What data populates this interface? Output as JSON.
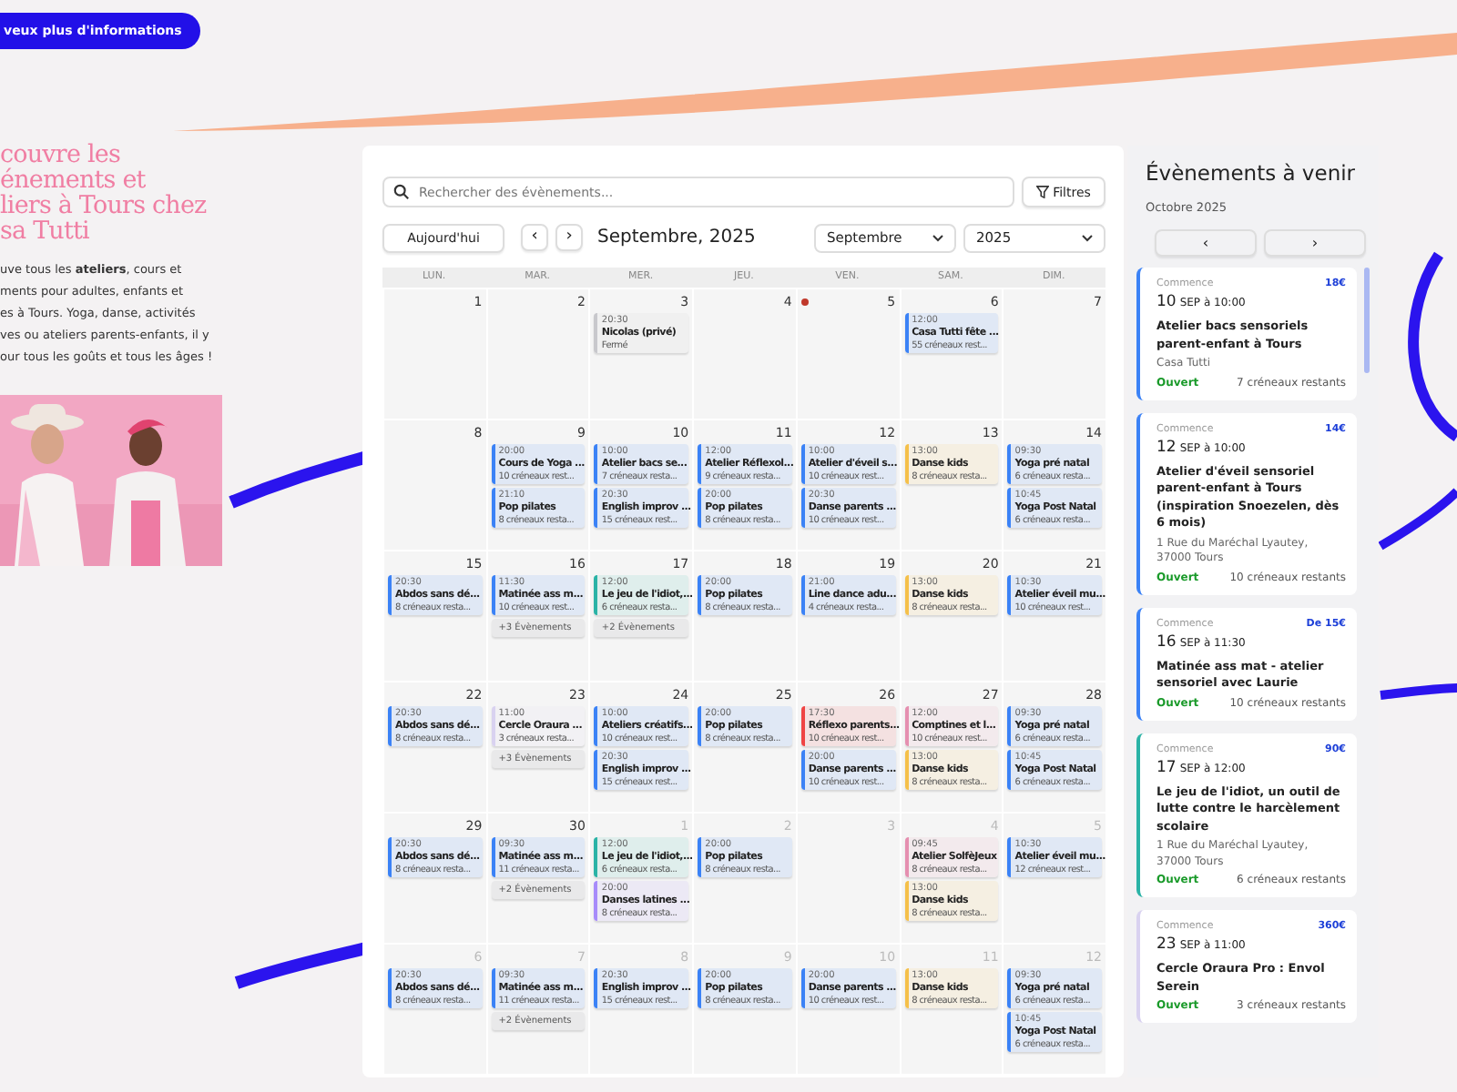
{
  "info_button": "veux plus d'informations",
  "intro": {
    "heading": [
      "couvre les",
      "énements et",
      "liers à Tours chez",
      "sa Tutti"
    ],
    "text": [
      "uve tous les **ateliers**, cours et",
      "ments pour adultes, enfants et",
      "es à Tours. Yoga, danse, activités",
      "ves ou ateliers parents-enfants, il y",
      "our tous les goûts et tous les âges !"
    ]
  },
  "calendar": {
    "search": {
      "placeholder": "Rechercher des évènements..."
    },
    "filter_button": "Filtres",
    "today_button": "Aujourd'hui",
    "prev": "‹",
    "next": "›",
    "title": "Septembre, 2025",
    "month_select": "Septembre",
    "year_select": "2025",
    "weekdays": [
      "LUN.",
      "MAR.",
      "MER.",
      "JEU.",
      "VEN.",
      "SAM.",
      "DIM."
    ],
    "weeks": [
      [
        {
          "day": "1",
          "current_month": true,
          "marker": false
        },
        {
          "day": "2",
          "current_month": true,
          "marker": false
        },
        {
          "day": "3",
          "current_month": true,
          "marker": false,
          "events": [
            {
              "time": "20:30",
              "title": "Nicolas (privé)",
              "slots": "Fermé",
              "color": "#c8c8cc"
            }
          ]
        },
        {
          "day": "4",
          "current_month": true,
          "marker": false
        },
        {
          "day": "5",
          "current_month": true,
          "marker": true
        },
        {
          "day": "6",
          "current_month": true,
          "marker": false,
          "events": [
            {
              "time": "12:00",
              "title": "Casa Tutti fête ...",
              "slots": "55 créneaux rest...",
              "color": "#3b82f6"
            }
          ]
        },
        {
          "day": "7",
          "current_month": true,
          "marker": false
        }
      ],
      [
        {
          "day": "8",
          "current_month": true,
          "marker": false
        },
        {
          "day": "9",
          "current_month": true,
          "marker": false,
          "events": [
            {
              "time": "20:00",
              "title": "Cours de Yoga ...",
              "slots": "10 créneaux rest...",
              "color": "#3b82f6"
            },
            {
              "time": "21:10",
              "title": "Pop pilates",
              "slots": "8 créneaux resta...",
              "color": "#3b82f6"
            }
          ]
        },
        {
          "day": "10",
          "current_month": true,
          "marker": false,
          "events": [
            {
              "time": "10:00",
              "title": "Atelier bacs se...",
              "slots": "7 créneaux resta...",
              "color": "#3b82f6"
            },
            {
              "time": "20:30",
              "title": "English improv ...",
              "slots": "15 créneaux rest...",
              "color": "#3b82f6"
            }
          ]
        },
        {
          "day": "11",
          "current_month": true,
          "marker": false,
          "events": [
            {
              "time": "12:00",
              "title": "Atelier Réflexol...",
              "slots": "9 créneaux resta...",
              "color": "#3b82f6"
            },
            {
              "time": "20:00",
              "title": "Pop pilates",
              "slots": "8 créneaux resta...",
              "color": "#3b82f6"
            }
          ]
        },
        {
          "day": "12",
          "current_month": true,
          "marker": false,
          "events": [
            {
              "time": "10:00",
              "title": "Atelier d'éveil s...",
              "slots": "10 créneaux rest...",
              "color": "#3b82f6"
            },
            {
              "time": "20:30",
              "title": "Danse parents ...",
              "slots": "10 créneaux rest...",
              "color": "#3b82f6"
            }
          ]
        },
        {
          "day": "13",
          "current_month": true,
          "marker": false,
          "events": [
            {
              "time": "13:00",
              "title": "Danse kids",
              "slots": "8 créneaux resta...",
              "color": "#f5c04a"
            }
          ]
        },
        {
          "day": "14",
          "current_month": true,
          "marker": false,
          "events": [
            {
              "time": "09:30",
              "title": "Yoga pré natal",
              "slots": "6 créneaux resta...",
              "color": "#3b82f6"
            },
            {
              "time": "10:45",
              "title": "Yoga Post Natal",
              "slots": "6 créneaux resta...",
              "color": "#3b82f6"
            }
          ]
        }
      ],
      [
        {
          "day": "15",
          "current_month": true,
          "marker": false,
          "events": [
            {
              "time": "20:30",
              "title": "Abdos sans dé...",
              "slots": "8 créneaux resta...",
              "color": "#3b82f6"
            }
          ]
        },
        {
          "day": "16",
          "current_month": true,
          "marker": false,
          "events": [
            {
              "time": "11:30",
              "title": "Matinée ass m...",
              "slots": "10 créneaux rest...",
              "color": "#3b82f6"
            }
          ],
          "more": "+3 Évènements"
        },
        {
          "day": "17",
          "current_month": true,
          "marker": false,
          "events": [
            {
              "time": "12:00",
              "title": "Le jeu de l'idiot,...",
              "slots": "6 créneaux resta...",
              "color": "#2ab3a6"
            }
          ],
          "more": "+2 Évènements"
        },
        {
          "day": "18",
          "current_month": true,
          "marker": false,
          "events": [
            {
              "time": "20:00",
              "title": "Pop pilates",
              "slots": "8 créneaux resta...",
              "color": "#3b82f6"
            }
          ]
        },
        {
          "day": "19",
          "current_month": true,
          "marker": false,
          "events": [
            {
              "time": "21:00",
              "title": "Line dance adu...",
              "slots": "4 créneaux resta...",
              "color": "#3b82f6"
            }
          ]
        },
        {
          "day": "20",
          "current_month": true,
          "marker": false,
          "events": [
            {
              "time": "13:00",
              "title": "Danse kids",
              "slots": "8 créneaux resta...",
              "color": "#f5c04a"
            }
          ]
        },
        {
          "day": "21",
          "current_month": true,
          "marker": false,
          "events": [
            {
              "time": "10:30",
              "title": "Atelier éveil mu...",
              "slots": "10 créneaux rest...",
              "color": "#3b82f6"
            }
          ]
        }
      ],
      [
        {
          "day": "22",
          "current_month": true,
          "marker": false,
          "events": [
            {
              "time": "20:30",
              "title": "Abdos sans dé...",
              "slots": "8 créneaux resta...",
              "color": "#3b82f6"
            }
          ]
        },
        {
          "day": "23",
          "current_month": true,
          "marker": false,
          "events": [
            {
              "time": "11:00",
              "title": "Cercle Oraura ...",
              "slots": "3 créneaux resta...",
              "color": "#d9d2f0"
            }
          ],
          "more": "+3 Évènements"
        },
        {
          "day": "24",
          "current_month": true,
          "marker": false,
          "events": [
            {
              "time": "10:00",
              "title": "Ateliers créatifs...",
              "slots": "10 créneaux rest...",
              "color": "#3b82f6"
            },
            {
              "time": "20:30",
              "title": "English improv ...",
              "slots": "15 créneaux rest...",
              "color": "#3b82f6"
            }
          ]
        },
        {
          "day": "25",
          "current_month": true,
          "marker": false,
          "events": [
            {
              "time": "20:00",
              "title": "Pop pilates",
              "slots": "8 créneaux resta...",
              "color": "#3b82f6"
            }
          ]
        },
        {
          "day": "26",
          "current_month": true,
          "marker": false,
          "events": [
            {
              "time": "17:30",
              "title": "Réflexo parents...",
              "slots": "10 créneaux rest...",
              "color": "#ef4444"
            },
            {
              "time": "20:00",
              "title": "Danse parents ...",
              "slots": "10 créneaux rest...",
              "color": "#3b82f6"
            }
          ]
        },
        {
          "day": "27",
          "current_month": true,
          "marker": false,
          "events": [
            {
              "time": "12:00",
              "title": "Comptines et l...",
              "slots": "10 créneaux rest...",
              "color": "#e58fb0"
            },
            {
              "time": "13:00",
              "title": "Danse kids",
              "slots": "8 créneaux resta...",
              "color": "#f5c04a"
            }
          ]
        },
        {
          "day": "28",
          "current_month": true,
          "marker": false,
          "events": [
            {
              "time": "09:30",
              "title": "Yoga pré natal",
              "slots": "6 créneaux resta...",
              "color": "#3b82f6"
            },
            {
              "time": "10:45",
              "title": "Yoga Post Natal",
              "slots": "6 créneaux resta...",
              "color": "#3b82f6"
            }
          ]
        }
      ],
      [
        {
          "day": "29",
          "current_month": true,
          "marker": false,
          "events": [
            {
              "time": "20:30",
              "title": "Abdos sans dé...",
              "slots": "8 créneaux resta...",
              "color": "#3b82f6"
            }
          ]
        },
        {
          "day": "30",
          "current_month": true,
          "marker": false,
          "events": [
            {
              "time": "09:30",
              "title": "Matinée ass m...",
              "slots": "11 créneaux resta...",
              "color": "#3b82f6"
            }
          ],
          "more": "+2 Évènements"
        },
        {
          "day": "1",
          "current_month": false,
          "marker": false,
          "events": [
            {
              "time": "12:00",
              "title": "Le jeu de l'idiot,...",
              "slots": "6 créneaux resta...",
              "color": "#2ab3a6"
            },
            {
              "time": "20:00",
              "title": "Danses latines ...",
              "slots": "8 créneaux resta...",
              "color": "#a78bfa"
            }
          ]
        },
        {
          "day": "2",
          "current_month": false,
          "marker": false,
          "events": [
            {
              "time": "20:00",
              "title": "Pop pilates",
              "slots": "8 créneaux resta...",
              "color": "#3b82f6"
            }
          ]
        },
        {
          "day": "3",
          "current_month": false,
          "marker": false
        },
        {
          "day": "4",
          "current_month": false,
          "marker": false,
          "events": [
            {
              "time": "09:45",
              "title": "Atelier SolfèJeux",
              "slots": "8 créneaux resta...",
              "color": "#e58fb0"
            },
            {
              "time": "13:00",
              "title": "Danse kids",
              "slots": "8 créneaux resta...",
              "color": "#f5c04a"
            }
          ]
        },
        {
          "day": "5",
          "current_month": false,
          "marker": false,
          "events": [
            {
              "time": "10:30",
              "title": "Atelier éveil mu...",
              "slots": "12 créneaux rest...",
              "color": "#3b82f6"
            }
          ]
        }
      ],
      [
        {
          "day": "6",
          "current_month": false,
          "marker": false,
          "events": [
            {
              "time": "20:30",
              "title": "Abdos sans dé...",
              "slots": "8 créneaux resta...",
              "color": "#3b82f6"
            }
          ]
        },
        {
          "day": "7",
          "current_month": false,
          "marker": false,
          "events": [
            {
              "time": "09:30",
              "title": "Matinée ass m...",
              "slots": "11 créneaux resta...",
              "color": "#3b82f6"
            }
          ],
          "more": "+2 Évènements"
        },
        {
          "day": "8",
          "current_month": false,
          "marker": false,
          "events": [
            {
              "time": "20:30",
              "title": "English improv ...",
              "slots": "15 créneaux rest...",
              "color": "#3b82f6"
            }
          ]
        },
        {
          "day": "9",
          "current_month": false,
          "marker": false,
          "events": [
            {
              "time": "20:00",
              "title": "Pop pilates",
              "slots": "8 créneaux resta...",
              "color": "#3b82f6"
            }
          ]
        },
        {
          "day": "10",
          "current_month": false,
          "marker": false,
          "events": [
            {
              "time": "20:00",
              "title": "Danse parents ...",
              "slots": "10 créneaux rest...",
              "color": "#3b82f6"
            }
          ]
        },
        {
          "day": "11",
          "current_month": false,
          "marker": false,
          "events": [
            {
              "time": "13:00",
              "title": "Danse kids",
              "slots": "8 créneaux resta...",
              "color": "#f5c04a"
            }
          ]
        },
        {
          "day": "12",
          "current_month": false,
          "marker": false,
          "events": [
            {
              "time": "09:30",
              "title": "Yoga pré natal",
              "slots": "6 créneaux resta...",
              "color": "#3b82f6"
            },
            {
              "time": "10:45",
              "title": "Yoga Post Natal",
              "slots": "6 créneaux resta...",
              "color": "#3b82f6"
            }
          ]
        }
      ]
    ]
  },
  "upcoming": {
    "title": "Évènements à venir",
    "month": "Octobre 2025",
    "prev": "‹",
    "next": "›",
    "cards": [
      {
        "label": "Commence",
        "price": "18€",
        "day": "10",
        "when": "SEP à 10:00",
        "title": "Atelier bacs sensoriels parent-enfant à Tours",
        "location": "Casa Tutti",
        "status": "Ouvert",
        "slots": "7 créneaux restants",
        "color": "#3b82f6"
      },
      {
        "label": "Commence",
        "price": "14€",
        "day": "12",
        "when": "SEP à 10:00",
        "title": "Atelier d'éveil sensoriel parent-enfant à Tours (inspiration Snoezelen, dès 6 mois)",
        "location": "1 Rue du Maréchal Lyautey, 37000 Tours",
        "status": "Ouvert",
        "slots": "10 créneaux restants",
        "color": "#3b82f6"
      },
      {
        "label": "Commence",
        "price": "De 15€",
        "day": "16",
        "when": "SEP à 11:30",
        "title": "Matinée ass mat - atelier sensoriel avec Laurie",
        "status": "Ouvert",
        "slots": "10 créneaux restants",
        "color": "#3b82f6"
      },
      {
        "label": "Commence",
        "price": "90€",
        "day": "17",
        "when": "SEP à 12:00",
        "title": "Le jeu de l'idiot, un outil de lutte contre le harcèlement scolaire",
        "location": "1 Rue du Maréchal Lyautey, 37000 Tours",
        "status": "Ouvert",
        "slots": "6 créneaux restants",
        "color": "#2ab3a6"
      },
      {
        "label": "Commence",
        "price": "360€",
        "day": "23",
        "when": "SEP à 11:00",
        "title": "Cercle Oraura Pro : Envol Serein",
        "status": "Ouvert",
        "slots": "3 créneaux restants",
        "color": "#d9d2f0"
      }
    ]
  }
}
